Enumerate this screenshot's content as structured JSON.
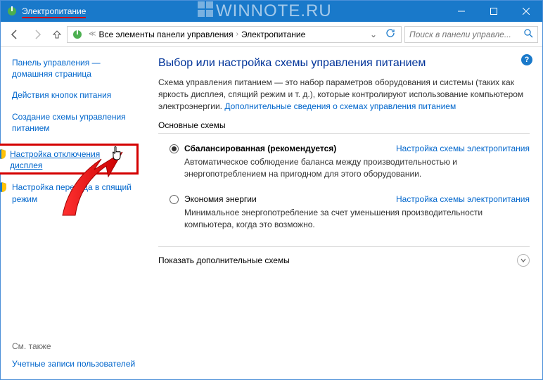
{
  "titlebar": {
    "title": "Электропитание",
    "watermark": "WINNOTE.RU"
  },
  "addressbar": {
    "breadcrumb": {
      "level1": "Все элементы панели управления",
      "level2": "Электропитание"
    },
    "search_placeholder": "Поиск в панели управле..."
  },
  "sidebar": {
    "home_label": "Панель управления — домашняя страница",
    "links": {
      "button_actions": "Действия кнопок питания",
      "create_plan": "Создание схемы управления питанием",
      "display_off": "Настройка отключения дисплея",
      "sleep_mode": "Настройка перехода в спящий режим"
    },
    "see_also": {
      "title": "См. также",
      "accounts": "Учетные записи пользователей"
    }
  },
  "content": {
    "heading": "Выбор или настройка схемы управления питанием",
    "description": "Схема управления питанием — это набор параметров оборудования и системы (таких как яркость дисплея, спящий режим и т. д.), которые контролируют использование компьютером электроэнергии. ",
    "more_link": "Дополнительные сведения о схемах управления питанием",
    "section_main": "Основные схемы",
    "plans": {
      "balanced": {
        "name": "Сбалансированная (рекомендуется)",
        "desc": "Автоматическое соблюдение баланса между производительностью и энергопотреблением на пригодном для этого оборудовании.",
        "link": "Настройка схемы электропитания"
      },
      "saver": {
        "name": "Экономия энергии",
        "desc": "Минимальное энергопотребление за счет уменьшения производительности компьютера, когда это возможно.",
        "link": "Настройка схемы электропитания"
      }
    },
    "expander": "Показать дополнительные схемы"
  }
}
